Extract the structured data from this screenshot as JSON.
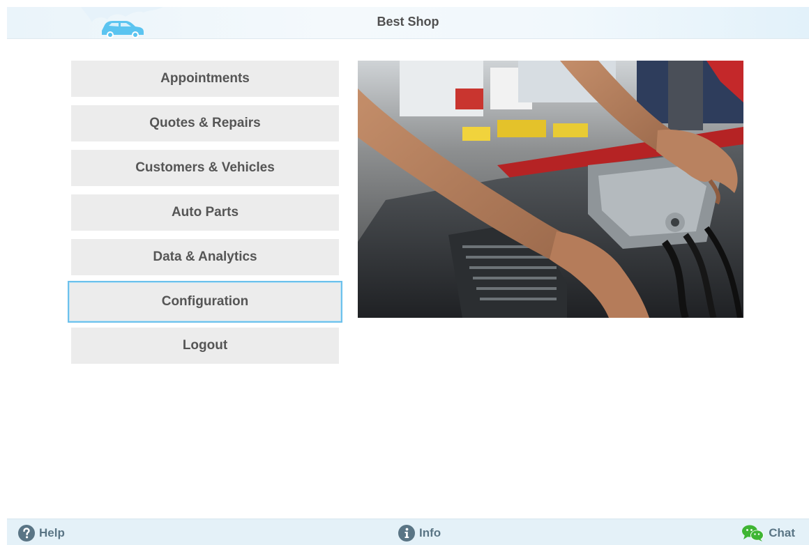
{
  "header": {
    "title": "Best Shop",
    "logo_icon": "car-icon",
    "accent_color": "#5bc4f0"
  },
  "menu": {
    "items": [
      {
        "label": "Appointments"
      },
      {
        "label": "Quotes & Repairs"
      },
      {
        "label": "Customers & Vehicles"
      },
      {
        "label": "Auto Parts"
      },
      {
        "label": "Data & Analytics"
      },
      {
        "label": "Configuration",
        "focused": true
      },
      {
        "label": "Logout"
      }
    ],
    "focus_color": "#6cc1ec"
  },
  "hero": {
    "description_icon": "mechanic-engine-photo"
  },
  "footer": {
    "help_label": "Help",
    "info_label": "Info",
    "chat_label": "Chat",
    "help_icon": "question-circle-icon",
    "info_icon": "info-circle-icon",
    "chat_icon": "chat-bubbles-icon",
    "icon_color": "#5a7585",
    "chat_icon_color": "#3fb534"
  }
}
